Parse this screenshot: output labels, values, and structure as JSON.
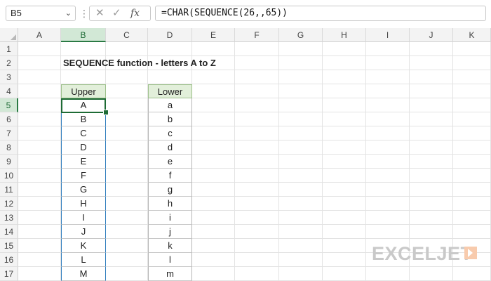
{
  "name_box": {
    "value": "B5",
    "dropdown_icon": "chevron-down-icon"
  },
  "formula_bar": {
    "cancel_icon": "✕",
    "enter_icon": "✓",
    "fx_label": "fx",
    "formula": "=CHAR(SEQUENCE(26,,65))"
  },
  "columns": [
    "A",
    "B",
    "C",
    "D",
    "E",
    "F",
    "G",
    "H",
    "I",
    "J",
    "K"
  ],
  "active_column": "B",
  "rows": [
    "1",
    "2",
    "3",
    "4",
    "5",
    "6",
    "7",
    "8",
    "9",
    "10",
    "11",
    "12",
    "13",
    "14",
    "15",
    "16",
    "17"
  ],
  "active_row": "5",
  "sheet": {
    "title": "SEQUENCE function - letters A to Z",
    "upper_header": "Upper",
    "lower_header": "Lower",
    "upper": [
      "A",
      "B",
      "C",
      "D",
      "E",
      "F",
      "G",
      "H",
      "I",
      "J",
      "K",
      "L",
      "M"
    ],
    "lower": [
      "a",
      "b",
      "c",
      "d",
      "e",
      "f",
      "g",
      "h",
      "i",
      "j",
      "k",
      "l",
      "m"
    ]
  },
  "watermark": {
    "text": "EXCELJET",
    "logo_color": "#f4b183"
  },
  "colors": {
    "accent": "#1e6b35",
    "header_fill": "#e2efda",
    "spill_border": "#2f7dbd"
  }
}
